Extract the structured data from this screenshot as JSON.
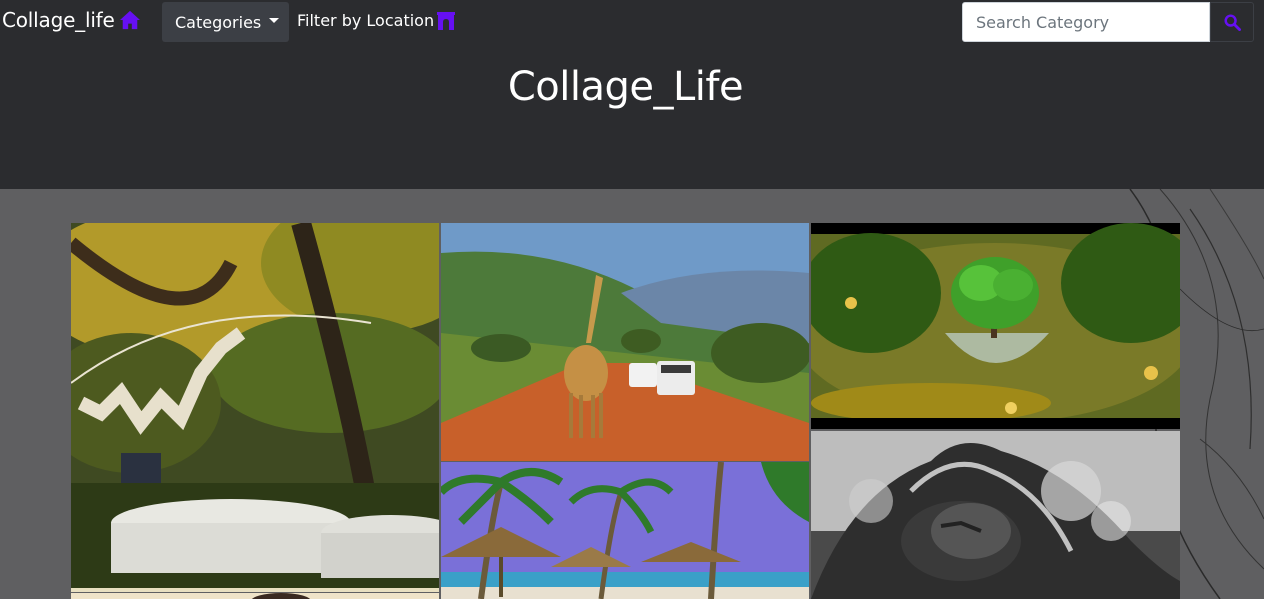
{
  "navbar": {
    "brand": "Collage_life",
    "brand_icon": "home-icon",
    "categories_label": "Categories",
    "filter_label": "Filter by Location",
    "filter_icon": "archway-icon",
    "search_placeholder": "Search Category",
    "search_icon": "search-icon",
    "accent_color": "#6610f2"
  },
  "hero": {
    "title": "Collage_Life"
  },
  "gallery": {
    "images": [
      "garden-wedding-photo",
      "safari-giraffe-photo",
      "tree-terrarium-photo",
      "beach-palms-photo",
      "wave-sculpture-photo",
      "portrait-photo"
    ]
  }
}
